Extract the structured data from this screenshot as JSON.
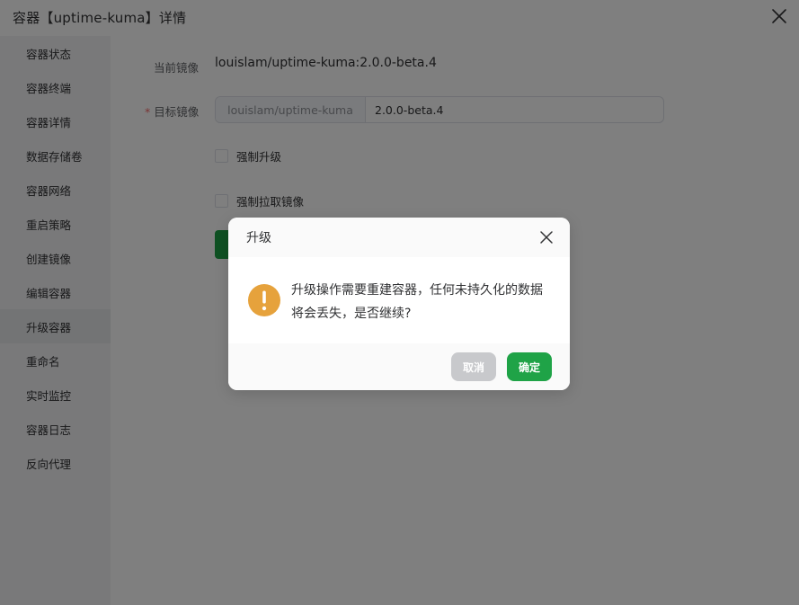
{
  "drawer": {
    "title": "容器【uptime-kuma】详情"
  },
  "sidebar": {
    "items": [
      {
        "label": "容器状态",
        "active": false
      },
      {
        "label": "容器终端",
        "active": false
      },
      {
        "label": "容器详情",
        "active": false
      },
      {
        "label": "数据存储卷",
        "active": false
      },
      {
        "label": "容器网络",
        "active": false
      },
      {
        "label": "重启策略",
        "active": false
      },
      {
        "label": "创建镜像",
        "active": false
      },
      {
        "label": "编辑容器",
        "active": false
      },
      {
        "label": "升级容器",
        "active": true
      },
      {
        "label": "重命名",
        "active": false
      },
      {
        "label": "实时监控",
        "active": false
      },
      {
        "label": "容器日志",
        "active": false
      },
      {
        "label": "反向代理",
        "active": false
      }
    ]
  },
  "form": {
    "current_image_label": "当前镜像",
    "current_image_value": "louislam/uptime-kuma:2.0.0-beta.4",
    "target_image_required_mark": "*",
    "target_image_label": "目标镜像",
    "target_image_prefix": "louislam/uptime-kuma",
    "target_image_tag": "2.0.0-beta.4",
    "force_upgrade_label": "强制升级",
    "force_pull_label": "强制拉取镜像"
  },
  "dialog": {
    "title": "升级",
    "message": "升级操作需要重建容器，任何未持久化的数据将会丢失，是否继续?",
    "cancel_label": "取消",
    "confirm_label": "确定"
  },
  "colors": {
    "primary": "#1fa347",
    "warning": "#e6a23c",
    "required": "#f56c6c",
    "disabled_button": "#c8c9cc"
  },
  "icons": {
    "drawer_close": "close-icon",
    "dialog_close": "close-icon",
    "dialog_warning": "warning-icon"
  }
}
